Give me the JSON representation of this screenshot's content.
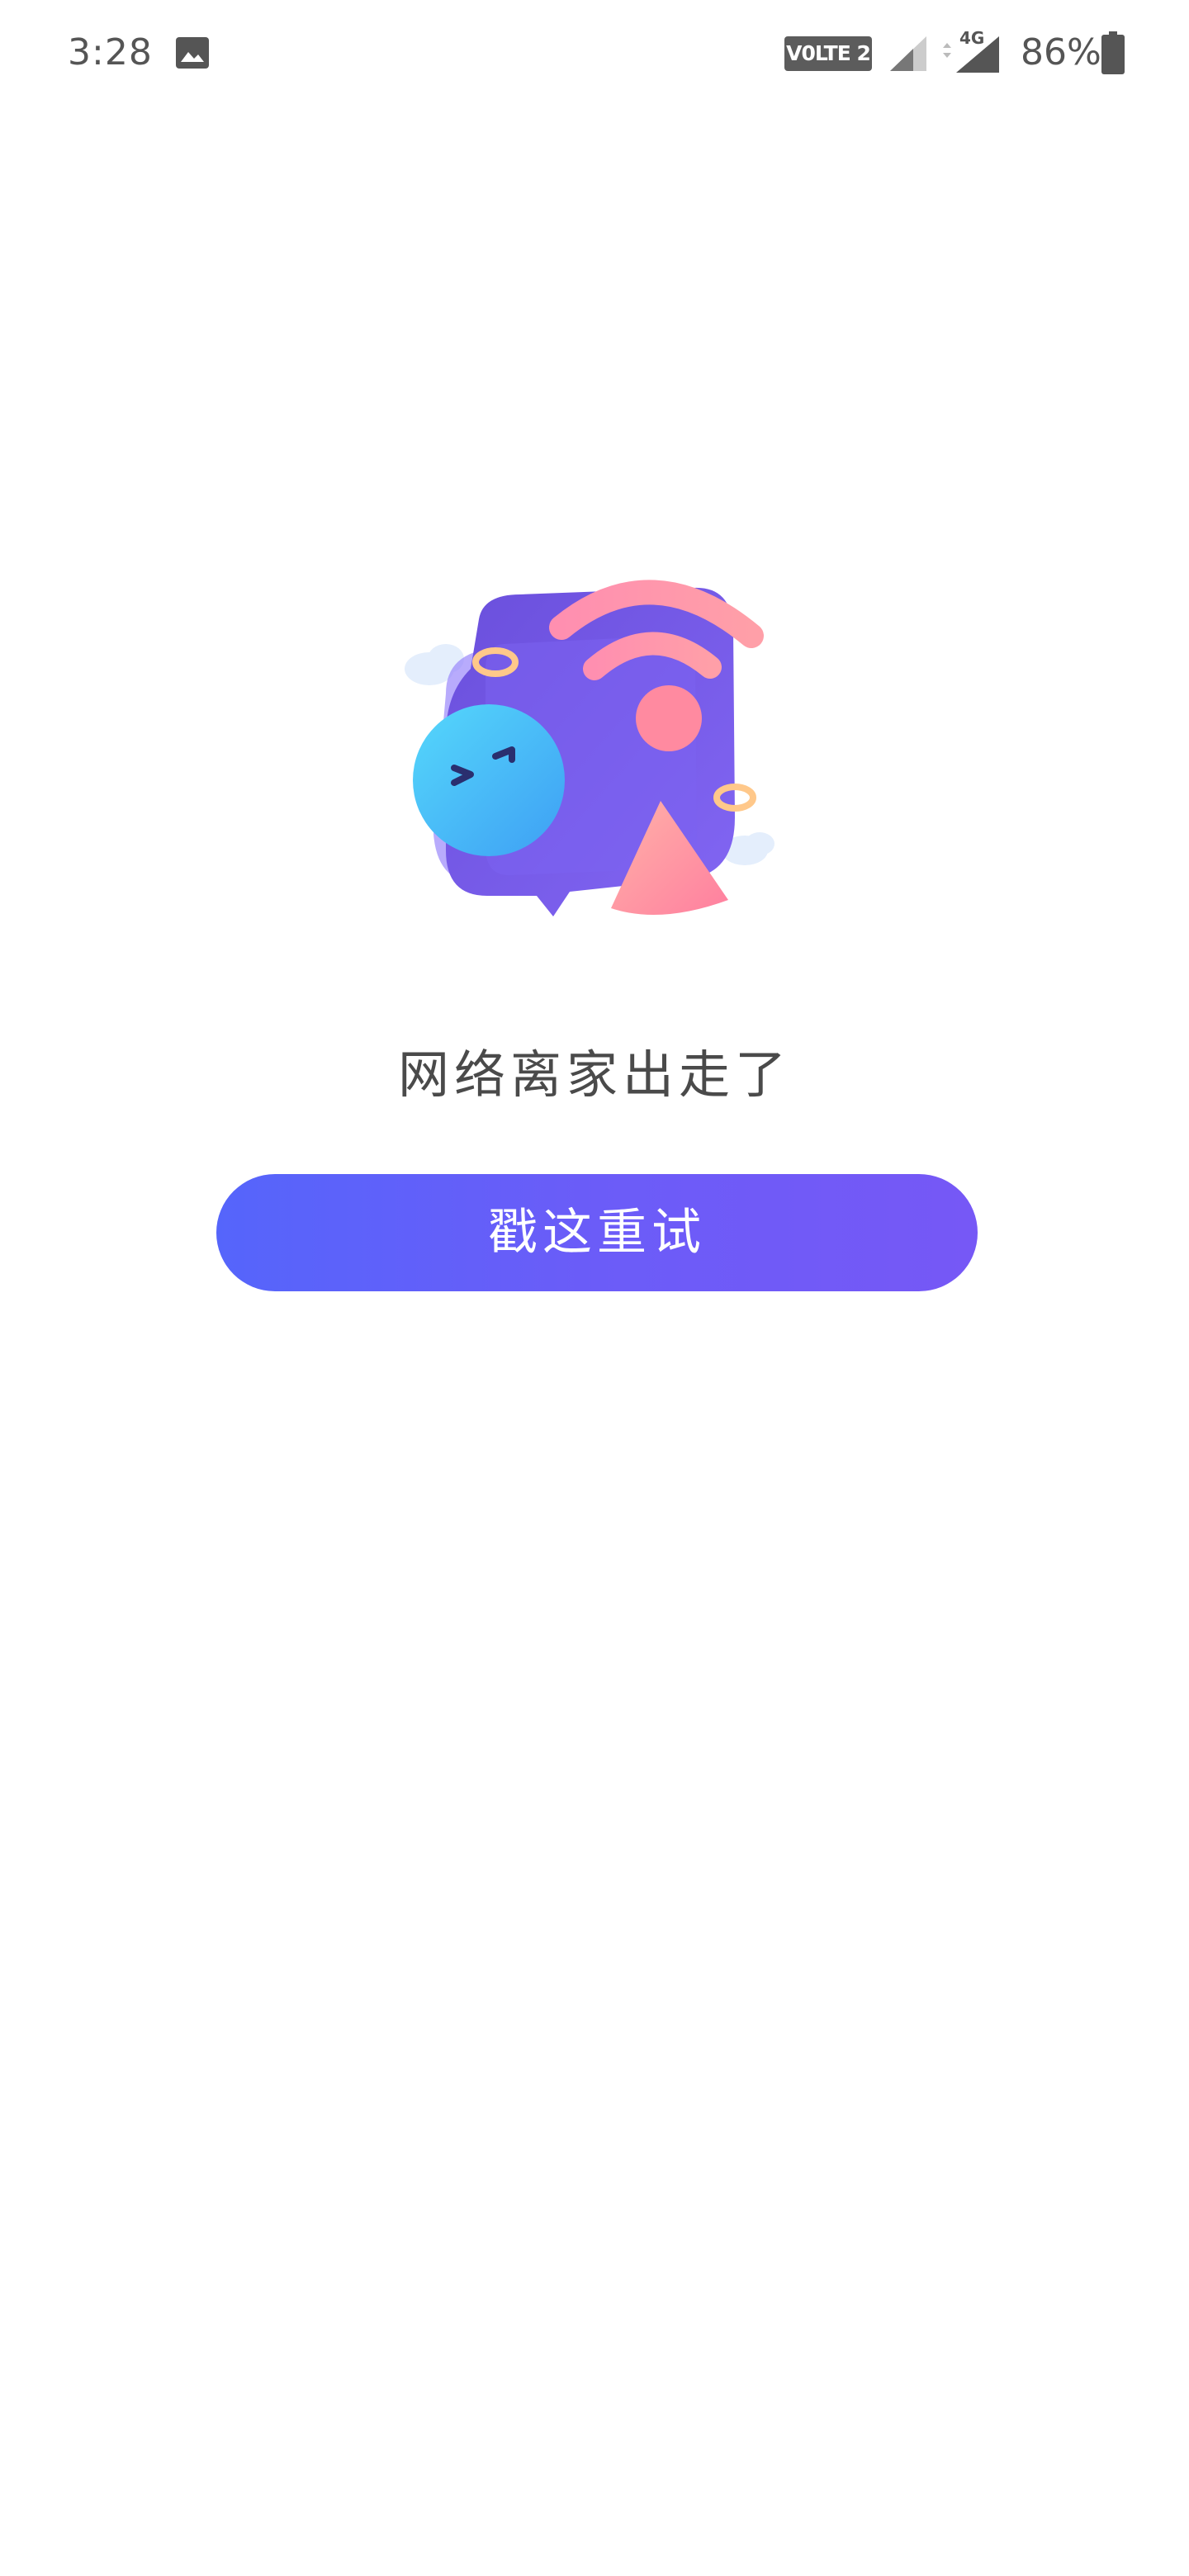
{
  "status_bar": {
    "time": "3:28",
    "gallery_icon": "image-icon",
    "volte_label": "V0LTE 2",
    "signal_icon": "cell-signal-icon",
    "network_type": "4G",
    "battery_percent": "86%",
    "battery_icon": "battery-icon"
  },
  "illustration": {
    "icon": "network-offline-illustration"
  },
  "error": {
    "message": "网络离家出走了"
  },
  "retry": {
    "label": "戳这重试"
  },
  "colors": {
    "button_start": "#5565fb",
    "button_end": "#7658f6",
    "text": "#4a4a4a",
    "status_text": "#555555"
  }
}
